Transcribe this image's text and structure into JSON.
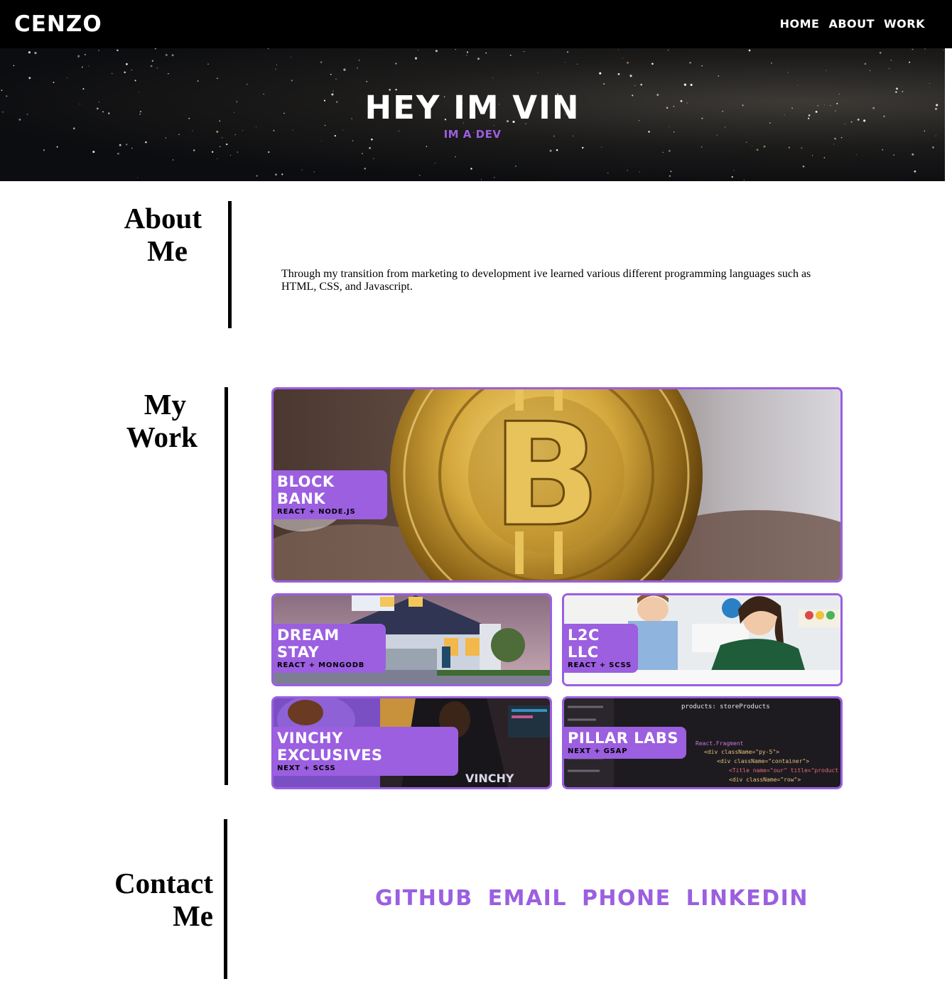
{
  "nav": {
    "brand": "CENZO",
    "links": [
      "Home",
      "About",
      "Work"
    ]
  },
  "hero": {
    "title": "HEY IM VIN",
    "subtitle": "IM A DEV"
  },
  "about": {
    "title_line1": "About",
    "title_line2": "Me",
    "text": "Through my transition from marketing to development ive learned various different programming languages such as HTML, CSS, and Javascript."
  },
  "work": {
    "title_line1": "My",
    "title_line2": "Work",
    "projects": [
      {
        "title": "Block Bank",
        "stack": "React + Node.js"
      },
      {
        "title": "Dream Stay",
        "stack": "React + MongoDB"
      },
      {
        "title": "L2C LLC",
        "stack": "React + SCSS"
      },
      {
        "title": "Vinchy Exclusives",
        "stack": "Next + SCSS"
      },
      {
        "title": "Pillar Labs",
        "stack": "Next + GSAP"
      }
    ]
  },
  "contact": {
    "title_line1": "Contact",
    "title_line2": "Me",
    "links": [
      "Github",
      "Email",
      "Phone",
      "LinkedIn"
    ]
  },
  "code_snippet": {
    "line1": "products: storeProducts",
    "line2": "React.Fragment",
    "line3": "<div className=\"py-5\">",
    "line4": "<div className=\"container\">",
    "line5": "<Title name=\"our\" title=\"product",
    "line6": "<div className=\"row\">"
  },
  "photo_lettering": "VINCHY",
  "colors": {
    "accent": "#9b5fe0",
    "nav_bg": "#000000",
    "text": "#000000"
  }
}
